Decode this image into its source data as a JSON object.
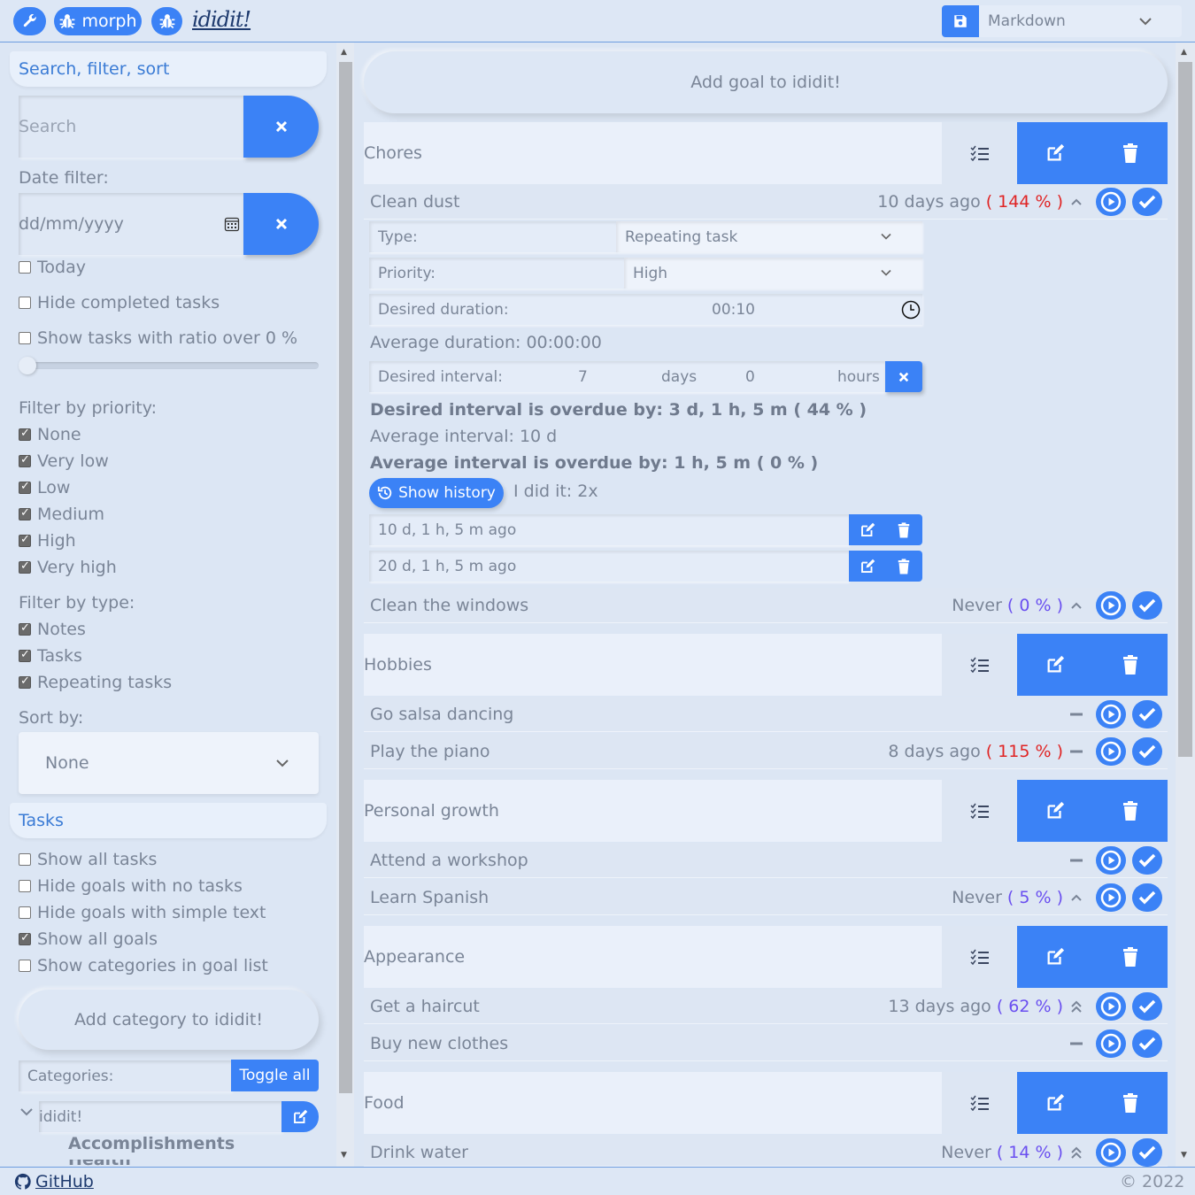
{
  "topbar": {
    "morph_label": "morph",
    "app_name": "ididit!",
    "format_selected": "Markdown"
  },
  "sidebar": {
    "search_section": "Search, filter, sort",
    "search_placeholder": "Search",
    "date_filter_label": "Date filter:",
    "date_placeholder": "dd/mm/yyyy",
    "today": "Today",
    "hide_completed": "Hide completed tasks",
    "ratio_label": "Show tasks with ratio over 0 %",
    "ratio_value": 0,
    "priority_label": "Filter by priority:",
    "priorities": [
      {
        "label": "None",
        "checked": true
      },
      {
        "label": "Very low",
        "checked": true
      },
      {
        "label": "Low",
        "checked": true
      },
      {
        "label": "Medium",
        "checked": true
      },
      {
        "label": "High",
        "checked": true
      },
      {
        "label": "Very high",
        "checked": true
      }
    ],
    "type_label": "Filter by type:",
    "types": [
      {
        "label": "Notes",
        "checked": true
      },
      {
        "label": "Tasks",
        "checked": true
      },
      {
        "label": "Repeating tasks",
        "checked": true
      }
    ],
    "sort_label": "Sort by:",
    "sort_value": "None",
    "tasks_section": "Tasks",
    "task_options": [
      {
        "label": "Show all tasks",
        "checked": false
      },
      {
        "label": "Hide goals with no tasks",
        "checked": false
      },
      {
        "label": "Hide goals with simple text",
        "checked": false
      },
      {
        "label": "Show all goals",
        "checked": true
      },
      {
        "label": "Show categories in goal list",
        "checked": false
      }
    ],
    "add_category": "Add category to ididit!",
    "categories_label": "Categories:",
    "toggle_all": "Toggle all",
    "category_name": "ididit!",
    "subcategory": "Accomplishments",
    "subcategory_cut": "Health"
  },
  "main": {
    "add_goal": "Add goal to ididit!",
    "goals": [
      {
        "title": "Chores"
      },
      {
        "title": "Hobbies"
      },
      {
        "title": "Personal growth"
      },
      {
        "title": "Appearance"
      },
      {
        "title": "Food"
      }
    ],
    "tasks": [
      {
        "name": "Clean dust",
        "when": "10 days ago",
        "ratio": "( 144 % )",
        "ratio_color": "red",
        "priority_icon": "chevron-up-icon"
      },
      {
        "name": "Clean the windows",
        "when": "Never",
        "ratio": "( 0 % )",
        "ratio_color": "purple",
        "priority_icon": "chevron-up-icon"
      },
      {
        "name": "Go salsa dancing",
        "when": "",
        "ratio": "",
        "ratio_color": "",
        "priority_icon": "dash-icon"
      },
      {
        "name": "Play the piano",
        "when": "8 days ago",
        "ratio": "( 115 % )",
        "ratio_color": "red",
        "priority_icon": "dash-icon"
      },
      {
        "name": "Attend a workshop",
        "when": "",
        "ratio": "",
        "ratio_color": "",
        "priority_icon": "dash-icon"
      },
      {
        "name": "Learn Spanish",
        "when": "Never",
        "ratio": "( 5 % )",
        "ratio_color": "purple",
        "priority_icon": "chevron-up-icon"
      },
      {
        "name": "Get a haircut",
        "when": "13 days ago",
        "ratio": "( 62 % )",
        "ratio_color": "purple",
        "priority_icon": "double-chevron-up-icon"
      },
      {
        "name": "Buy new clothes",
        "when": "",
        "ratio": "",
        "ratio_color": "",
        "priority_icon": "dash-icon"
      },
      {
        "name": "Drink water",
        "when": "Never",
        "ratio": "( 14 % )",
        "ratio_color": "purple",
        "priority_icon": "double-chevron-up-icon"
      }
    ],
    "detail": {
      "type_label": "Type:",
      "type_value": "Repeating task",
      "priority_label": "Priority:",
      "priority_value": "High",
      "duration_label": "Desired duration:",
      "duration_value": "00:10",
      "avg_duration": "Average duration: 00:00:00",
      "interval_label": "Desired interval:",
      "interval_days": "7",
      "days_unit": "days",
      "interval_hours": "0",
      "hours_unit": "hours",
      "overdue_desired": "Desired interval is overdue by: 3 d, 1 h, 5 m ( 44 % )",
      "avg_interval": "Average interval: 10 d",
      "overdue_avg": "Average interval is overdue by: 1 h, 5 m ( 0 % )",
      "show_history": "Show history",
      "did_it": "I did it: 2x",
      "history": [
        "10 d, 1 h, 5 m ago",
        "20 d, 1 h, 5 m ago"
      ]
    }
  },
  "footer": {
    "github": "GitHub",
    "copyright": "© 2022"
  },
  "colors": {
    "accent": "#3b82f6",
    "background": "#dce6f4",
    "overdue": "#e02424",
    "ok": "#6a4ff0"
  }
}
